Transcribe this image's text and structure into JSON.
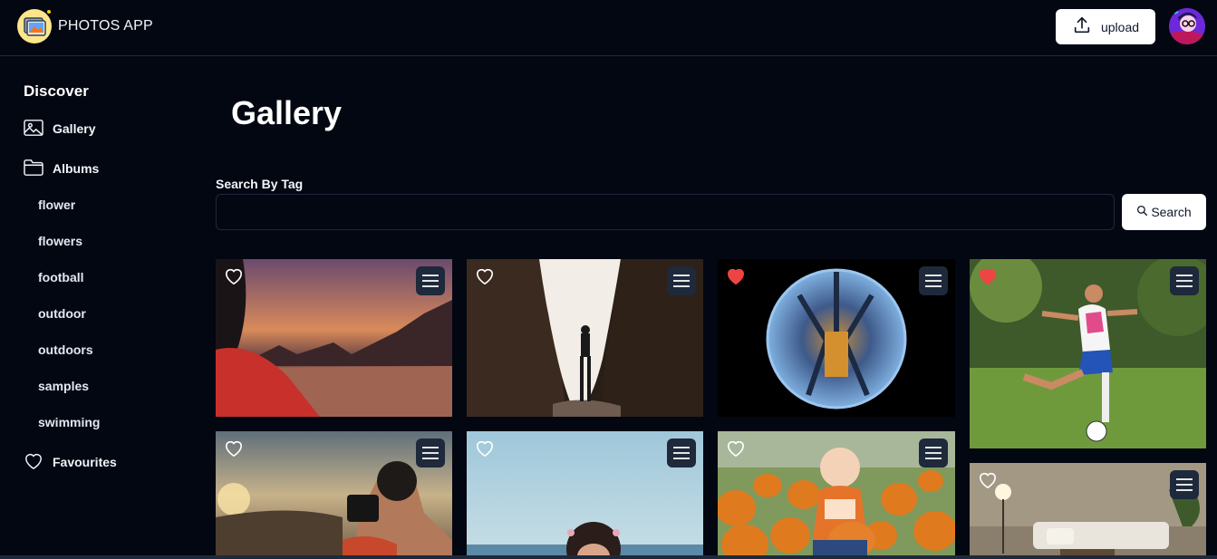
{
  "header": {
    "app_title": "PHOTOS APP",
    "upload_label": "upload"
  },
  "sidebar": {
    "discover": "Discover",
    "gallery": "Gallery",
    "albums": "Albums",
    "album_list": [
      "flower",
      "flowers",
      "football",
      "outdoor",
      "outdoors",
      "samples",
      "swimming"
    ],
    "favourites": "Favourites"
  },
  "main": {
    "title": "Gallery",
    "search_label": "Search By Tag",
    "search_value": "",
    "search_button": "Search"
  },
  "photos": [
    {
      "favourite": false
    },
    {
      "favourite": false
    },
    {
      "favourite": true
    },
    {
      "favourite": true
    },
    {
      "favourite": false
    },
    {
      "favourite": false
    },
    {
      "favourite": false
    },
    {
      "favourite": false
    }
  ],
  "colors": {
    "background": "#030712",
    "border": "#1e293b",
    "favourite_red": "#ef4444"
  }
}
